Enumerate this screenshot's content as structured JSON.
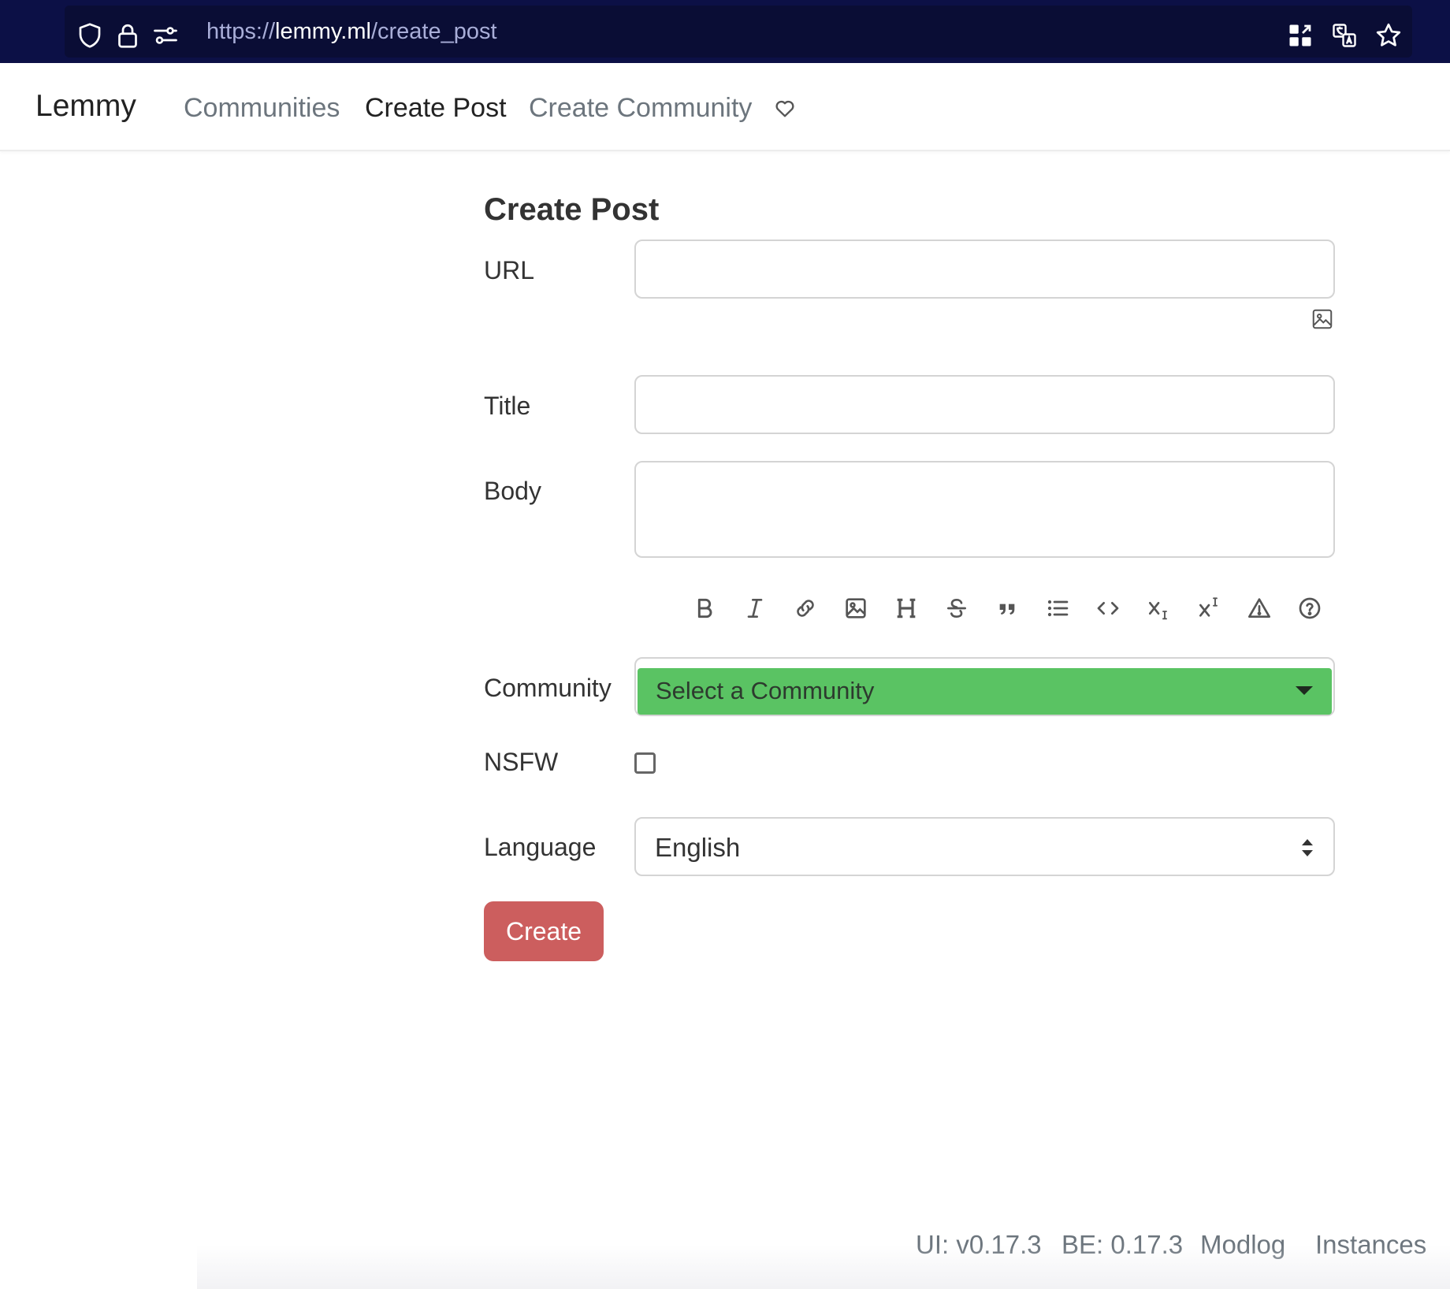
{
  "browser": {
    "url_scheme": "https://",
    "url_host": "lemmy.ml",
    "url_path": "/create_post",
    "icons": [
      "shield-icon",
      "lock-icon",
      "permissions-icon",
      "qr-code-icon",
      "translate-icon",
      "bookmark-star-icon"
    ]
  },
  "navbar": {
    "brand": "Lemmy",
    "links": [
      {
        "label": "Communities",
        "active": false
      },
      {
        "label": "Create Post",
        "active": true
      },
      {
        "label": "Create Community",
        "active": false
      }
    ],
    "donate_icon": "heart-icon"
  },
  "form": {
    "title": "Create Post",
    "url_label": "URL",
    "url_value": "",
    "title_label": "Title",
    "title_value": "",
    "body_label": "Body",
    "body_value": "",
    "toolbar_icons": [
      "bold-icon",
      "italic-icon",
      "link-icon",
      "image-icon",
      "header-icon",
      "strikethrough-icon",
      "quote-icon",
      "list-icon",
      "code-icon",
      "subscript-icon",
      "superscript-icon",
      "spoiler-icon",
      "help-icon"
    ],
    "community_label": "Community",
    "community_placeholder": "Select a Community",
    "nsfw_label": "NSFW",
    "nsfw_checked": false,
    "language_label": "Language",
    "language_value": "English",
    "submit_label": "Create"
  },
  "footer": {
    "ui_version": "UI: v0.17.3",
    "be_version": "BE: 0.17.3",
    "modlog": "Modlog",
    "instances": "Instances"
  },
  "colors": {
    "browser_bar": "#0c1046",
    "community_select": "#5ac363",
    "create_button": "#cc5e5e"
  }
}
